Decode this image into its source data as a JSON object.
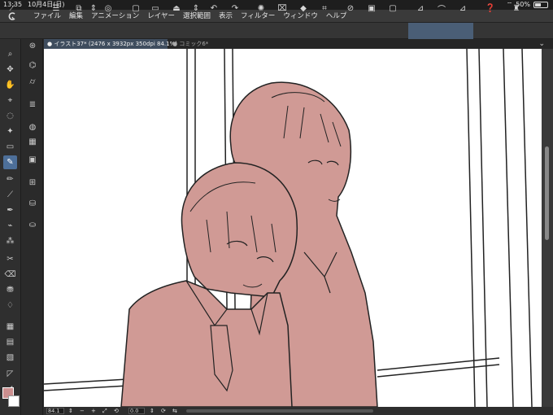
{
  "status_bar": {
    "time": "13:35",
    "date": "10月4日(日)",
    "battery": "50%",
    "battery_level": 0.5
  },
  "menu": {
    "items": [
      "ファイル",
      "編集",
      "アニメーション",
      "レイヤー",
      "選択範囲",
      "表示",
      "フィルター",
      "ウィンドウ",
      "ヘルプ"
    ]
  },
  "tabs": [
    {
      "label": "イラスト37* (2476 x 3932px 350dpi 84.1%)",
      "active": true
    },
    {
      "label": "コミック6*",
      "active": false
    }
  ],
  "navigator": {
    "zoom": "84.1",
    "angle": "0.0"
  },
  "colors": {
    "accent": "#4d6f99",
    "main_color": "#cc8f8f",
    "sub_color": "#ffffff",
    "fill_color": "#d09a95"
  }
}
